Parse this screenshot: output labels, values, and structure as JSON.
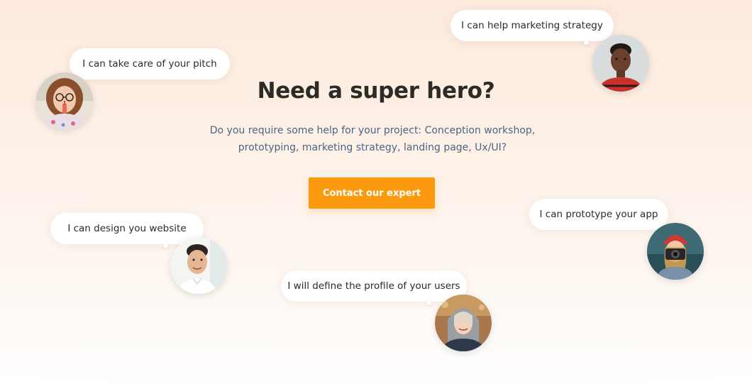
{
  "hero": {
    "title": "Need a super hero?",
    "subtitle": "Do you require some help for your project: Conception workshop, prototyping, marketing strategy, landing page, Ux/UI?",
    "cta_label": "Contact our expert"
  },
  "experts": [
    {
      "quote": "I can take care of your pitch",
      "avatar_icon": "woman-glasses-avatar"
    },
    {
      "quote": "I can help marketing strategy",
      "avatar_icon": "man-red-shirt-avatar"
    },
    {
      "quote": "I can design you website",
      "avatar_icon": "man-white-shirt-avatar"
    },
    {
      "quote": "I can prototype your app",
      "avatar_icon": "woman-camera-avatar"
    },
    {
      "quote": "I will define the profile of your users",
      "avatar_icon": "woman-hood-avatar"
    }
  ],
  "colors": {
    "accent": "#fb9a0e",
    "title": "#2e2a26",
    "subtitle": "#4e6482",
    "background": "#fdeee3"
  }
}
